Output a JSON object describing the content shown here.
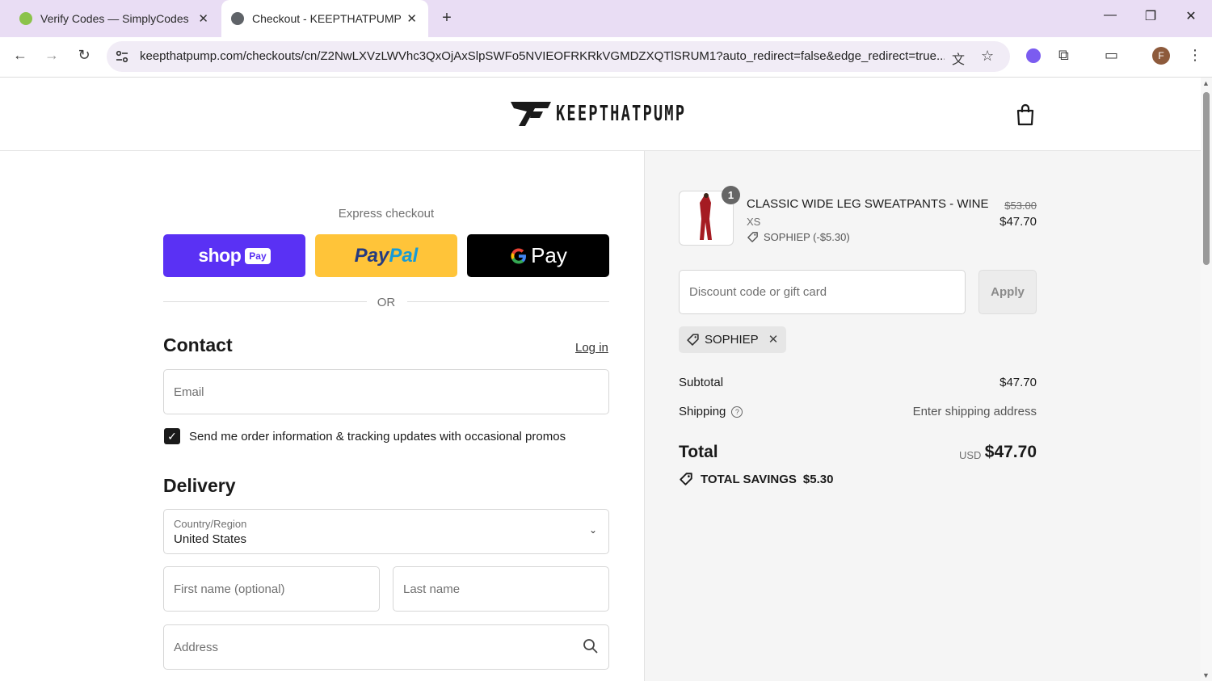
{
  "browser": {
    "tabs": [
      {
        "title": "Verify Codes — SimplyCodes",
        "active": false
      },
      {
        "title": "Checkout - KEEPTHATPUMP",
        "active": true
      }
    ],
    "new_tab": "+",
    "url": "keepthatpump.com/checkouts/cn/Z2NwLXVzLWVhc3QxOjAxSlpSWFo5NVIEOFRKRkVGMDZXQTlSRUM1?auto_redirect=false&edge_redirect=true...",
    "profile_initial": "F",
    "icons": [
      "back-icon",
      "forward-icon",
      "reload-icon",
      "site-settings-icon",
      "translate-icon",
      "star-icon",
      "extension-icon",
      "puzzle-icon",
      "cast-icon",
      "profile-avatar",
      "menu-icon"
    ]
  },
  "store": {
    "brand": "KEEPTHATPUMP"
  },
  "express": {
    "label": "Express checkout",
    "shoppay_text": "shop",
    "shoppay_badge": "Pay",
    "paypal_text_a": "Pay",
    "paypal_text_b": "Pal",
    "gpay_text": "Pay",
    "or": "OR",
    "colors": {
      "shoppay": "#5a31f4",
      "paypal": "#ffc439",
      "gpay": "#000000"
    }
  },
  "contact": {
    "heading": "Contact",
    "login": "Log in",
    "email_placeholder": "Email",
    "promo_checkbox_checked": true,
    "promo_label": "Send me order information & tracking updates with occasional promos"
  },
  "delivery": {
    "heading": "Delivery",
    "country_label": "Country/Region",
    "country_value": "United States",
    "first_name_placeholder": "First name (optional)",
    "last_name_placeholder": "Last name",
    "address_placeholder": "Address"
  },
  "summary": {
    "item": {
      "quantity": "1",
      "name": "CLASSIC WIDE LEG SWEATPANTS - WINE",
      "size": "XS",
      "discount": "SOPHIEP (-$5.30)",
      "original_price": "$53.00",
      "price": "$47.70"
    },
    "discount_placeholder": "Discount code or gift card",
    "apply": "Apply",
    "applied_code": "SOPHIEP",
    "subtotal_label": "Subtotal",
    "subtotal_value": "$47.70",
    "shipping_label": "Shipping",
    "shipping_value": "Enter shipping address",
    "total_label": "Total",
    "currency": "USD",
    "total_value": "$47.70",
    "savings_label": "TOTAL SAVINGS",
    "savings_value": "$5.30"
  }
}
